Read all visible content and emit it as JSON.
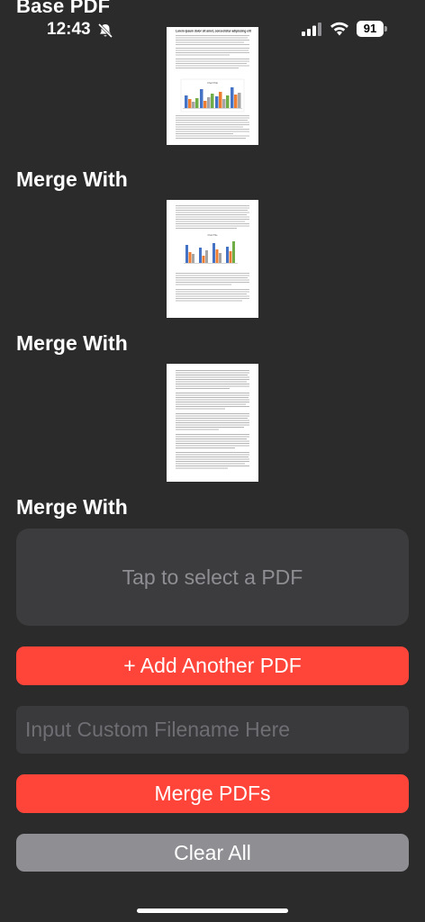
{
  "header": {
    "title": "Base PDF"
  },
  "status_bar": {
    "time": "12:43",
    "battery": "91",
    "icons": [
      "bell-slash-icon",
      "cellular-signal-icon",
      "wifi-icon",
      "battery-icon"
    ]
  },
  "sections": {
    "merge_label_1": "Merge With",
    "merge_label_2": "Merge With",
    "merge_label_3": "Merge With"
  },
  "thumbnails": {
    "doc1_heading": "Lorem ipsum dolor sit amet, consectetur adipiscing elit",
    "doc1_chart_title": "Chart Title",
    "doc2_chart_title": "Chart Title"
  },
  "picker": {
    "label": "Tap to select a PDF"
  },
  "buttons": {
    "add_label": "+ Add Another PDF",
    "merge_label": "Merge PDFs",
    "clear_label": "Clear All"
  },
  "filename": {
    "placeholder": "Input Custom Filename Here",
    "value": ""
  },
  "colors": {
    "background": "#2b2b2b",
    "accent": "#ff453a",
    "secondary": "#8e8e93",
    "field": "#3a3a3c"
  }
}
